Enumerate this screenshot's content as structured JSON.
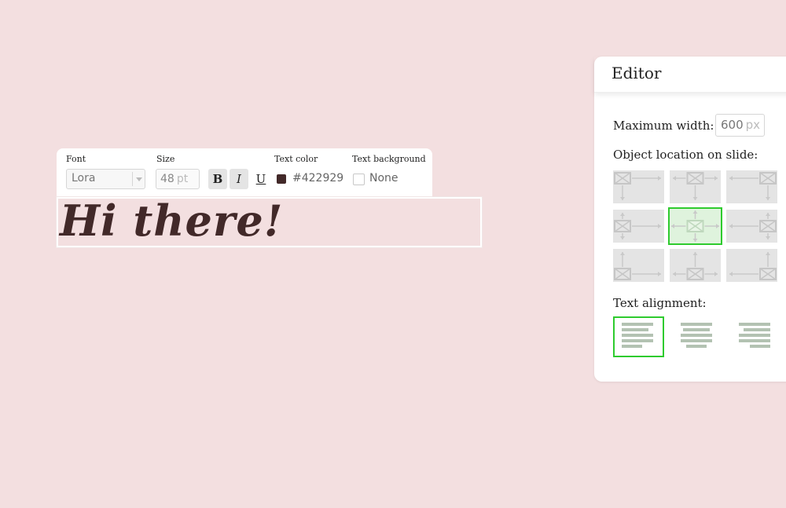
{
  "toolbar": {
    "font_label": "Font",
    "font_value": "Lora",
    "size_label": "Size",
    "size_value": "48",
    "size_unit": "pt",
    "bold_label": "B",
    "italic_label": "I",
    "underline_label": "U",
    "text_color_label": "Text color",
    "text_color_value": "#422929",
    "text_bg_label": "Text background",
    "text_bg_value": "None"
  },
  "slide": {
    "text": "Hi there!"
  },
  "editor": {
    "title": "Editor",
    "max_width_label": "Maximum width:",
    "max_width_value": "600",
    "max_width_unit": "px",
    "location_label": "Object location on slide:",
    "location_selected": "middle-center",
    "alignment_label": "Text alignment:",
    "alignment_selected": "left"
  },
  "colors": {
    "background": "#f3dfe0",
    "text": "#422929",
    "accent": "#2ecb2e"
  }
}
